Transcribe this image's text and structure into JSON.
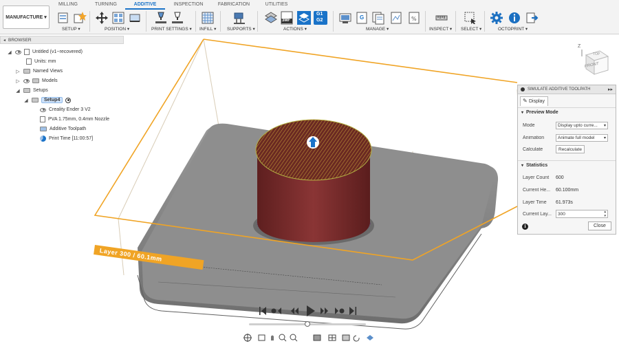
{
  "workspace": {
    "label": "MANUFACTURE",
    "arrow": "▾"
  },
  "tabs": [
    {
      "label": "MILLING",
      "active": false
    },
    {
      "label": "TURNING",
      "active": false
    },
    {
      "label": "ADDITIVE",
      "active": true
    },
    {
      "label": "INSPECTION",
      "active": false
    },
    {
      "label": "FABRICATION",
      "active": false
    },
    {
      "label": "UTILITIES",
      "active": false
    }
  ],
  "groups": [
    {
      "label": "SETUP ▾"
    },
    {
      "label": "POSITION ▾"
    },
    {
      "label": "PRINT SETTINGS ▾"
    },
    {
      "label": "INFILL ▾"
    },
    {
      "label": "SUPPORTS ▾"
    },
    {
      "label": "ACTIONS ▾"
    },
    {
      "label": "MANAGE ▾"
    },
    {
      "label": "INSPECT ▾"
    },
    {
      "label": "SELECT ▾"
    },
    {
      "label": "OCTOPRINT ▾"
    }
  ],
  "toolbar_icon_text": {
    "threemf": "3MF",
    "gcode_top": "G1",
    "gcode_bottom": "G2",
    "gcode_g": "G"
  },
  "browser": {
    "title": "BROWSER",
    "items": [
      {
        "label": "Untitled (v1~recovered)"
      },
      {
        "label": "Units: mm"
      },
      {
        "label": "Named Views"
      },
      {
        "label": "Models"
      },
      {
        "label": "Setups"
      },
      {
        "label": "Setup4"
      },
      {
        "label": "Creality Ender 3 V2"
      },
      {
        "label": "PVA 1.75mm, 0.4mm Nozzle"
      },
      {
        "label": "Additive Toolpath"
      },
      {
        "label": "Print Time [11:00:57]"
      }
    ]
  },
  "viewport": {
    "layer_label": "Layer 300 / 60.1mm"
  },
  "viewcube": {
    "face": "FRONT",
    "top": "TOP",
    "axis_z": "Z"
  },
  "simulate_panel": {
    "title": "SIMULATE ADDITIVE TOOLPATH",
    "tab": "Display",
    "preview_section": "Preview Mode",
    "mode_label": "Mode",
    "mode_value": "Display upto curre...",
    "animation_label": "Animation",
    "animation_value": "Animate full model",
    "calculate_label": "Calculate",
    "recalculate_button": "Recalculate",
    "statistics_section": "Statistics",
    "layer_count_label": "Layer Count",
    "layer_count_value": "600",
    "current_height_label": "Current He...",
    "current_height_value": "60.100mm",
    "layer_time_label": "Layer Time",
    "layer_time_value": "61.973s",
    "current_layer_label": "Current Lay...",
    "current_layer_value": "300",
    "close_button": "Close",
    "info_icon": "i"
  },
  "playback": {
    "progress": 0.5
  },
  "colors": {
    "accent": "#1a73c8",
    "layer_orange": "#f0a425",
    "part_red": "#7a2c2c",
    "bed_gray": "#8e8e8e"
  }
}
